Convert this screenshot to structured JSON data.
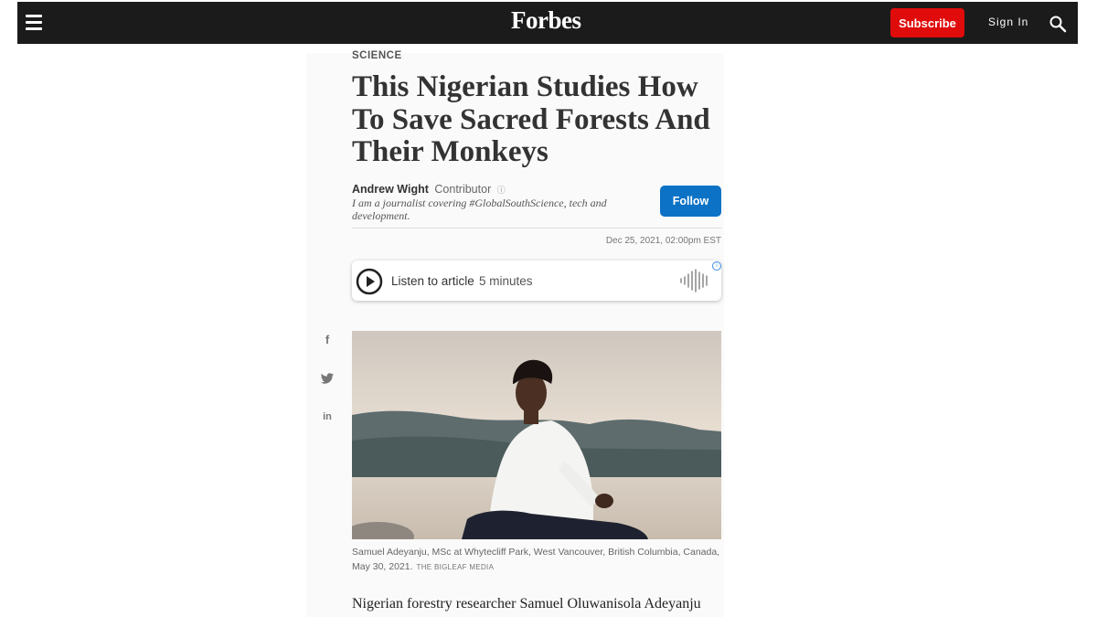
{
  "header": {
    "logo": "Forbes",
    "subscribe_label": "Subscribe",
    "signin_label": "Sign In",
    "menu_icon": "hamburger-menu-icon",
    "search_icon": "search-icon",
    "colors": {
      "bar": "#1b1b1b",
      "subscribe": "#e00b0b"
    }
  },
  "article": {
    "section": "SCIENCE",
    "headline": "This Nigerian Studies How To Save Sacred Forests And Their Monkeys",
    "author": {
      "name": "Andrew Wight",
      "role": "Contributor",
      "bio": "I am a journalist covering #GlobalSouthScience, tech and development.",
      "follow_label": "Follow"
    },
    "date": "Dec 25, 2021, 02:00pm EST",
    "listen": {
      "label": "Listen to article",
      "duration": "5 minutes"
    },
    "share": {
      "facebook": "f",
      "linkedin": "in"
    },
    "caption": "Samuel Adeyanju, MSc at Whytecliff Park, West Vancouver, British Columbia, Canada, May 30, 2021.",
    "credit": "THE BIGLEAF MEDIA",
    "body_start": "Nigerian forestry researcher Samuel Oluwanisola Adeyanju"
  }
}
